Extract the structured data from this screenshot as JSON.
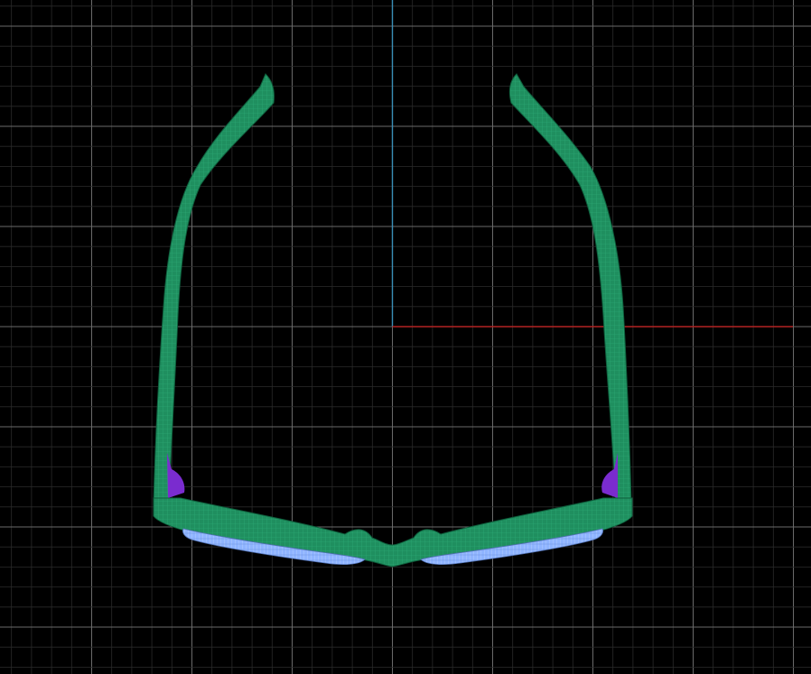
{
  "viewport": {
    "view": "top",
    "background_color": "#000000",
    "grid": {
      "visible": true,
      "minor_color": "#2a2a2a",
      "major_color": "#6a6a6a"
    },
    "axes": {
      "x_axis_color": "#b22222",
      "y_axis_color": "#3a8fb7"
    }
  },
  "model": {
    "object": "eyeglasses",
    "display": "wireframe-on-shaded",
    "parts": [
      {
        "name": "frame-and-temples",
        "color": "#1f8f5f"
      },
      {
        "name": "lenses",
        "color": "#8fb4ff"
      },
      {
        "name": "hinges",
        "color": "#7a2ccf"
      }
    ]
  }
}
